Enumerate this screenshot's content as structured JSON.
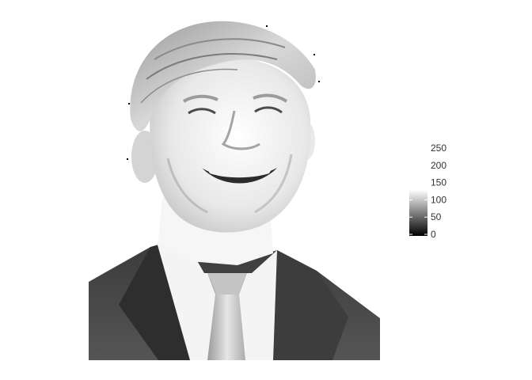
{
  "chart_data": {
    "type": "heatmap",
    "title": "",
    "xlabel": "",
    "ylabel": "",
    "image_subject": "grayscale raster portrait of a smiling man in a dark suit, white shirt and light tie",
    "color_scale": {
      "low_color": "#000000",
      "high_color": "#ffffff",
      "limits": [
        0,
        255
      ],
      "breaks": [
        0,
        50,
        100,
        150,
        200,
        250
      ],
      "break_labels": [
        "0",
        "50",
        "100",
        "150",
        "200",
        "250"
      ]
    },
    "legend_position": "right",
    "axes_visible": false,
    "grid": false
  }
}
